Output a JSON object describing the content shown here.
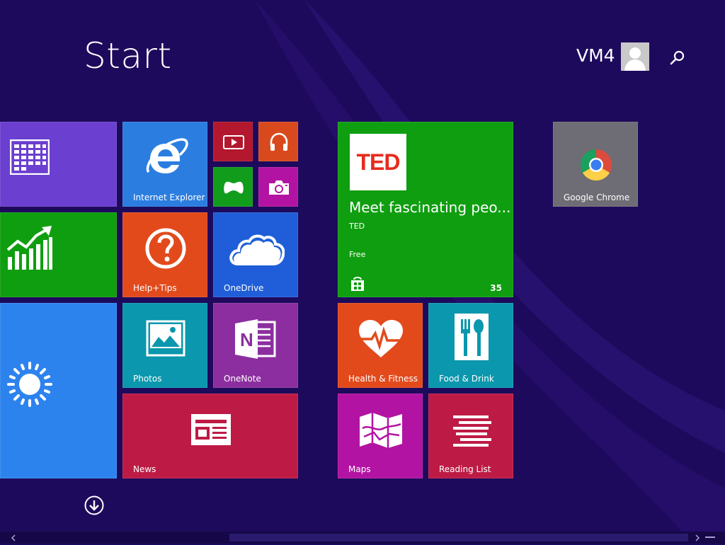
{
  "header": {
    "title": "Start",
    "user_name": "VM4"
  },
  "tiles": {
    "calendar": {
      "label": "",
      "color": "#6b3fcf"
    },
    "internet_explorer": {
      "label": "Internet Explorer",
      "color": "#2b7ee0"
    },
    "video": {
      "label": "",
      "color": "#b3182e"
    },
    "music": {
      "label": "",
      "color": "#d84a1e"
    },
    "games": {
      "label": "",
      "color": "#119c1c"
    },
    "camera": {
      "label": "",
      "color": "#b213a2"
    },
    "finance": {
      "label": "",
      "color": "#0f9e10"
    },
    "help_tips": {
      "label": "Help+Tips",
      "color": "#e24a1c"
    },
    "onedrive": {
      "label": "OneDrive",
      "color": "#1f5ed8"
    },
    "weather": {
      "label": "",
      "color": "#2d83ee"
    },
    "photos": {
      "label": "Photos",
      "color": "#0b97ad"
    },
    "onenote": {
      "label": "OneNote",
      "color": "#8c2e9f"
    },
    "news": {
      "label": "News",
      "color": "#bd1b45"
    },
    "ted": {
      "logo_text": "TED",
      "headline": "Meet fascinating peo...",
      "publisher": "TED",
      "price": "Free",
      "count": "35",
      "color": "#0f9e10"
    },
    "health_fitness": {
      "label": "Health & Fitness",
      "color": "#e24a1c"
    },
    "food_drink": {
      "label": "Food & Drink",
      "color": "#0b97ad"
    },
    "maps": {
      "label": "Maps",
      "color": "#b213a2"
    },
    "reading_list": {
      "label": "Reading List",
      "color": "#bd1b45"
    },
    "google_chrome": {
      "label": "Google Chrome",
      "color": "#6e6c74"
    }
  },
  "icons": {
    "search": "search-icon",
    "all_apps": "arrow-down-circle-icon",
    "scroll_left": "chevron-left-icon",
    "scroll_right": "chevron-right-icon"
  }
}
